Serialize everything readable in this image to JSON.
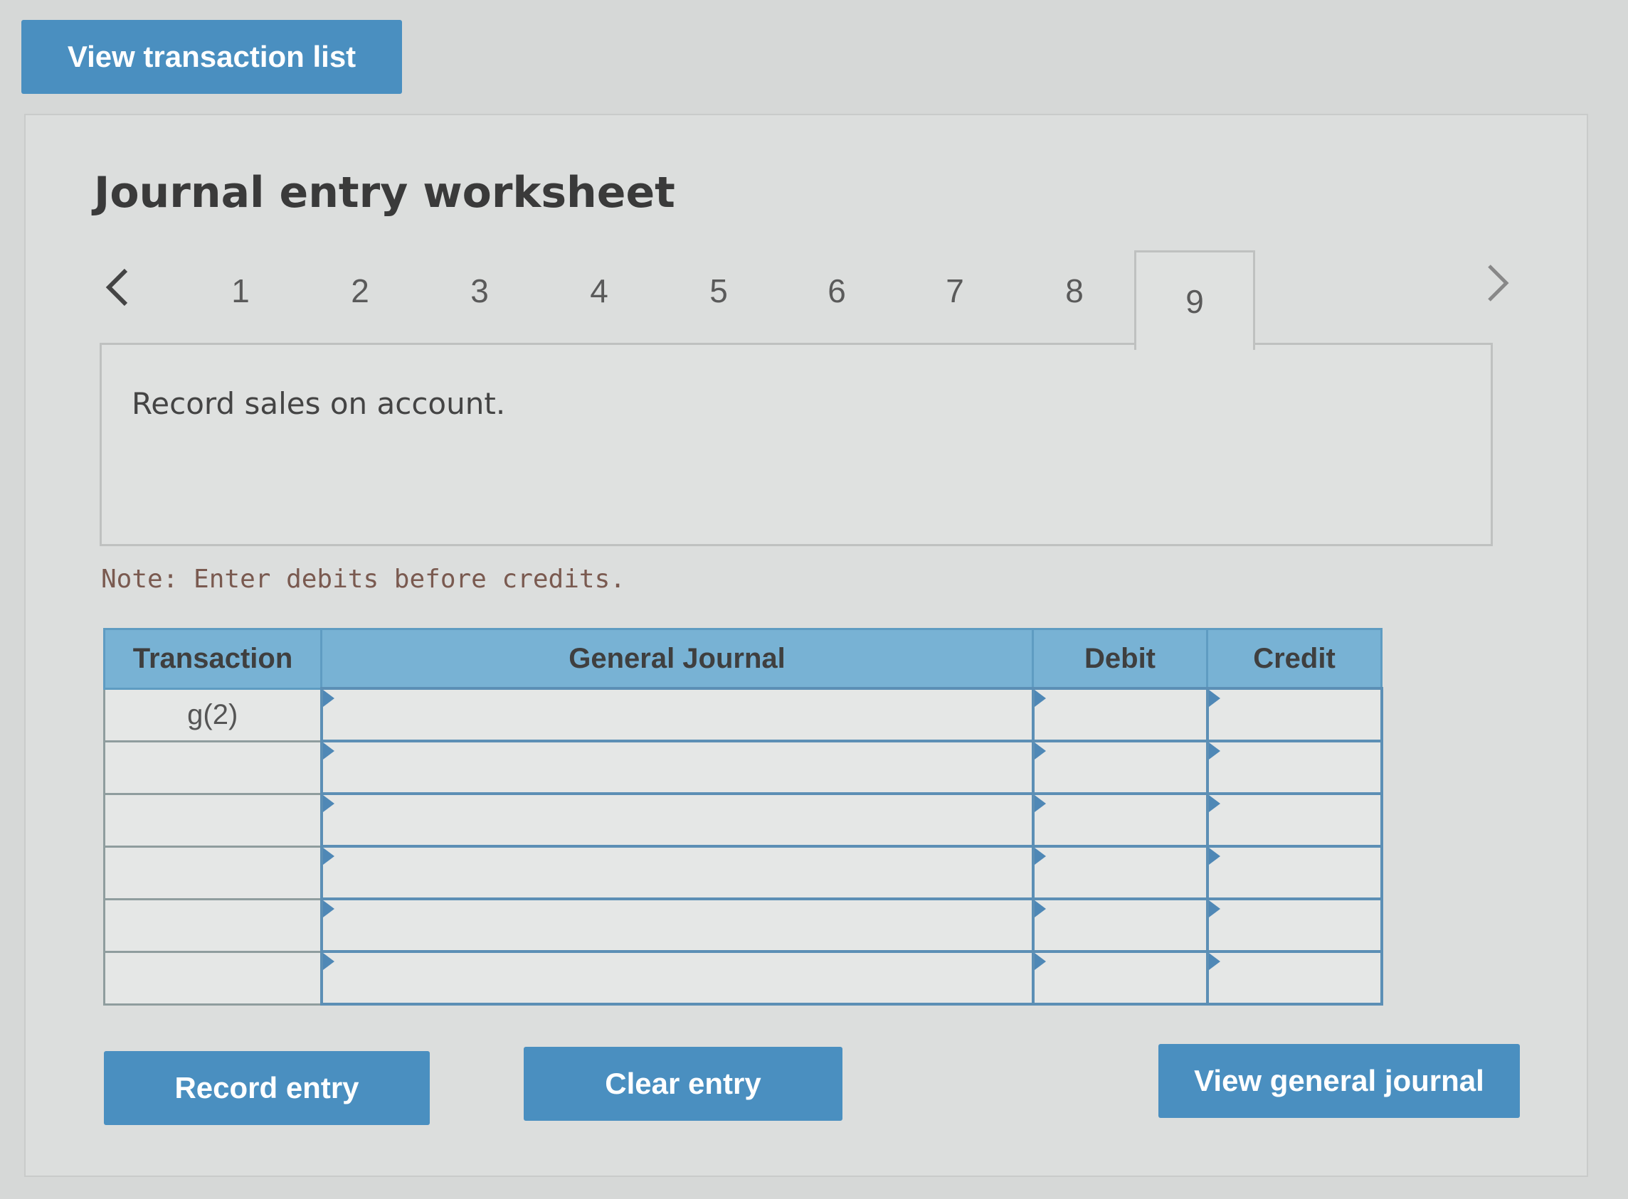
{
  "top_button": {
    "label": "View transaction list"
  },
  "worksheet": {
    "title": "Journal entry worksheet",
    "tabs": [
      "1",
      "2",
      "3",
      "4",
      "5",
      "6",
      "7",
      "8",
      "9"
    ],
    "active_tab": "9",
    "description": "Record sales on account.",
    "note": "Note: Enter debits before credits."
  },
  "table": {
    "headers": {
      "transaction": "Transaction",
      "general_journal": "General Journal",
      "debit": "Debit",
      "credit": "Credit"
    },
    "rows": [
      {
        "transaction": "g(2)",
        "account": "",
        "debit": "",
        "credit": ""
      },
      {
        "transaction": "",
        "account": "",
        "debit": "",
        "credit": ""
      },
      {
        "transaction": "",
        "account": "",
        "debit": "",
        "credit": ""
      },
      {
        "transaction": "",
        "account": "",
        "debit": "",
        "credit": ""
      },
      {
        "transaction": "",
        "account": "",
        "debit": "",
        "credit": ""
      },
      {
        "transaction": "",
        "account": "",
        "debit": "",
        "credit": ""
      }
    ]
  },
  "buttons": {
    "record": "Record entry",
    "clear": "Clear entry",
    "view_journal": "View general journal"
  },
  "colors": {
    "button": "#4a8fc0",
    "table_header": "#78b2d4",
    "background": "#d6d8d7"
  },
  "icons": {
    "prev": "chevron-left-icon",
    "next": "chevron-right-icon"
  }
}
